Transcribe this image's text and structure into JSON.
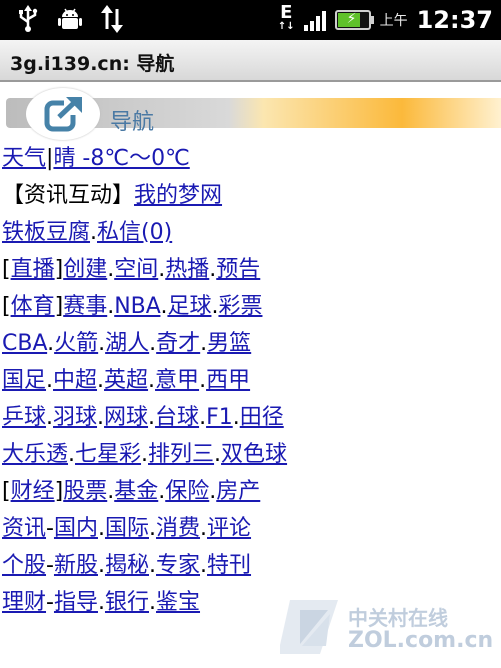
{
  "statusbar": {
    "network_label": "E",
    "ampm": "上午",
    "time": "12:37",
    "battery_level": 0.8,
    "signal_bars": 4
  },
  "titlebar": {
    "title": "3g.i139.cn: 导航"
  },
  "banner": {
    "label": "导航"
  },
  "lines": [
    [
      {
        "text": "天气",
        "link": true
      },
      {
        "text": "|",
        "link": false
      },
      {
        "text": "晴 -8℃～0℃",
        "link": true
      }
    ],
    [
      {
        "text": "【资讯互动】",
        "link": false
      },
      {
        "text": "我的梦网",
        "link": true
      }
    ],
    [
      {
        "text": "铁板豆腐",
        "link": true
      },
      {
        "text": ".",
        "link": false
      },
      {
        "text": "私信(0)",
        "link": true
      }
    ],
    [
      {
        "text": "[",
        "link": false
      },
      {
        "text": "直播",
        "link": true
      },
      {
        "text": "]",
        "link": false
      },
      {
        "text": "创建",
        "link": true
      },
      {
        "text": ".",
        "link": false
      },
      {
        "text": "空间",
        "link": true
      },
      {
        "text": ".",
        "link": false
      },
      {
        "text": "热播",
        "link": true
      },
      {
        "text": ".",
        "link": false
      },
      {
        "text": "预告",
        "link": true
      }
    ],
    [
      {
        "text": "[",
        "link": false
      },
      {
        "text": "体育",
        "link": true
      },
      {
        "text": "]",
        "link": false
      },
      {
        "text": "赛事",
        "link": true
      },
      {
        "text": ".",
        "link": false
      },
      {
        "text": "NBA",
        "link": true
      },
      {
        "text": ".",
        "link": false
      },
      {
        "text": "足球",
        "link": true
      },
      {
        "text": ".",
        "link": false
      },
      {
        "text": "彩票",
        "link": true
      }
    ],
    [
      {
        "text": "CBA",
        "link": true
      },
      {
        "text": ".",
        "link": false
      },
      {
        "text": "火箭",
        "link": true
      },
      {
        "text": ".",
        "link": false
      },
      {
        "text": "湖人",
        "link": true
      },
      {
        "text": ".",
        "link": false
      },
      {
        "text": "奇才",
        "link": true
      },
      {
        "text": ".",
        "link": false
      },
      {
        "text": "男篮",
        "link": true
      }
    ],
    [
      {
        "text": "国足",
        "link": true
      },
      {
        "text": ".",
        "link": false
      },
      {
        "text": "中超",
        "link": true
      },
      {
        "text": ".",
        "link": false
      },
      {
        "text": "英超",
        "link": true
      },
      {
        "text": ".",
        "link": false
      },
      {
        "text": "意甲",
        "link": true
      },
      {
        "text": ".",
        "link": false
      },
      {
        "text": "西甲",
        "link": true
      }
    ],
    [
      {
        "text": "乒球",
        "link": true
      },
      {
        "text": ".",
        "link": false
      },
      {
        "text": "羽球",
        "link": true
      },
      {
        "text": ".",
        "link": false
      },
      {
        "text": "网球",
        "link": true
      },
      {
        "text": ".",
        "link": false
      },
      {
        "text": "台球",
        "link": true
      },
      {
        "text": ".",
        "link": false
      },
      {
        "text": "F1",
        "link": true
      },
      {
        "text": ".",
        "link": false
      },
      {
        "text": "田径",
        "link": true
      }
    ],
    [
      {
        "text": "大乐透",
        "link": true
      },
      {
        "text": ".",
        "link": false
      },
      {
        "text": "七星彩",
        "link": true
      },
      {
        "text": ".",
        "link": false
      },
      {
        "text": "排列三",
        "link": true
      },
      {
        "text": ".",
        "link": false
      },
      {
        "text": "双色球",
        "link": true
      }
    ],
    [
      {
        "text": "[",
        "link": false
      },
      {
        "text": "财经",
        "link": true
      },
      {
        "text": "]",
        "link": false
      },
      {
        "text": "股票",
        "link": true
      },
      {
        "text": ".",
        "link": false
      },
      {
        "text": "基金",
        "link": true
      },
      {
        "text": ".",
        "link": false
      },
      {
        "text": "保险",
        "link": true
      },
      {
        "text": ".",
        "link": false
      },
      {
        "text": "房产",
        "link": true
      }
    ],
    [
      {
        "text": "资讯",
        "link": true
      },
      {
        "text": "-",
        "link": false
      },
      {
        "text": "国内",
        "link": true
      },
      {
        "text": ".",
        "link": false
      },
      {
        "text": "国际",
        "link": true
      },
      {
        "text": ".",
        "link": false
      },
      {
        "text": "消费",
        "link": true
      },
      {
        "text": ".",
        "link": false
      },
      {
        "text": "评论",
        "link": true
      }
    ],
    [
      {
        "text": "个股",
        "link": true
      },
      {
        "text": "-",
        "link": false
      },
      {
        "text": "新股",
        "link": true
      },
      {
        "text": ".",
        "link": false
      },
      {
        "text": "揭秘",
        "link": true
      },
      {
        "text": ".",
        "link": false
      },
      {
        "text": "专家",
        "link": true
      },
      {
        "text": ".",
        "link": false
      },
      {
        "text": "特刊",
        "link": true
      }
    ],
    [
      {
        "text": "理财",
        "link": true
      },
      {
        "text": "-",
        "link": false
      },
      {
        "text": "指导",
        "link": true
      },
      {
        "text": ".",
        "link": false
      },
      {
        "text": "银行",
        "link": true
      },
      {
        "text": ".",
        "link": false
      },
      {
        "text": "鉴宝",
        "link": true
      }
    ]
  ],
  "watermark": {
    "line1": "中关村在线",
    "line2": "ZOL.com.cn"
  },
  "colors": {
    "link": "#1a1ab2",
    "banner_text": "#4a79a4",
    "banner_accent": "#fbb93b",
    "battery_fill": "#5fc12a"
  },
  "icons": {
    "statusbar": [
      "usb-icon",
      "android-debug-icon",
      "data-transfer-icon",
      "signal-icon",
      "battery-charging-icon"
    ],
    "banner": "share-arrow-icon"
  }
}
